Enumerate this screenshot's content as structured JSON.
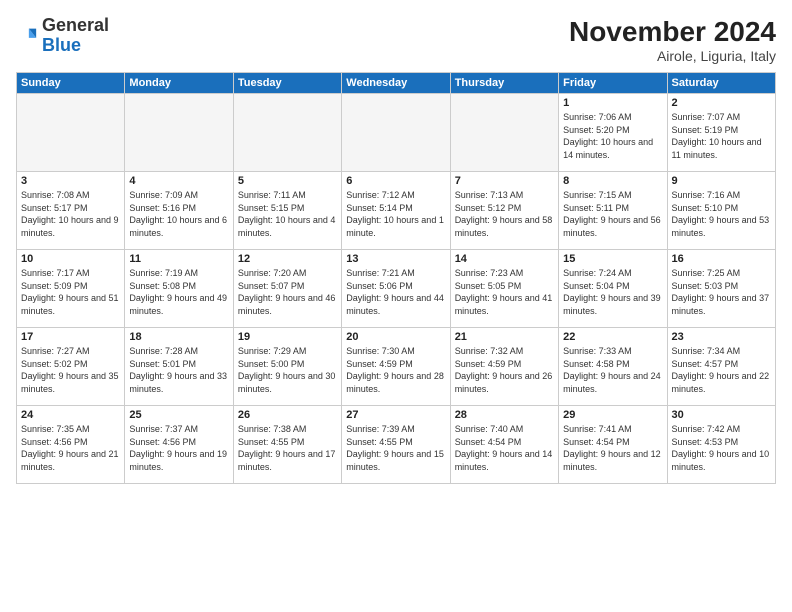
{
  "logo": {
    "general": "General",
    "blue": "Blue"
  },
  "header": {
    "title": "November 2024",
    "location": "Airole, Liguria, Italy"
  },
  "weekdays": [
    "Sunday",
    "Monday",
    "Tuesday",
    "Wednesday",
    "Thursday",
    "Friday",
    "Saturday"
  ],
  "days": [
    {
      "num": "",
      "info": ""
    },
    {
      "num": "",
      "info": ""
    },
    {
      "num": "",
      "info": ""
    },
    {
      "num": "",
      "info": ""
    },
    {
      "num": "",
      "info": ""
    },
    {
      "num": "1",
      "info": "Sunrise: 7:06 AM\nSunset: 5:20 PM\nDaylight: 10 hours and 14 minutes."
    },
    {
      "num": "2",
      "info": "Sunrise: 7:07 AM\nSunset: 5:19 PM\nDaylight: 10 hours and 11 minutes."
    },
    {
      "num": "3",
      "info": "Sunrise: 7:08 AM\nSunset: 5:17 PM\nDaylight: 10 hours and 9 minutes."
    },
    {
      "num": "4",
      "info": "Sunrise: 7:09 AM\nSunset: 5:16 PM\nDaylight: 10 hours and 6 minutes."
    },
    {
      "num": "5",
      "info": "Sunrise: 7:11 AM\nSunset: 5:15 PM\nDaylight: 10 hours and 4 minutes."
    },
    {
      "num": "6",
      "info": "Sunrise: 7:12 AM\nSunset: 5:14 PM\nDaylight: 10 hours and 1 minute."
    },
    {
      "num": "7",
      "info": "Sunrise: 7:13 AM\nSunset: 5:12 PM\nDaylight: 9 hours and 58 minutes."
    },
    {
      "num": "8",
      "info": "Sunrise: 7:15 AM\nSunset: 5:11 PM\nDaylight: 9 hours and 56 minutes."
    },
    {
      "num": "9",
      "info": "Sunrise: 7:16 AM\nSunset: 5:10 PM\nDaylight: 9 hours and 53 minutes."
    },
    {
      "num": "10",
      "info": "Sunrise: 7:17 AM\nSunset: 5:09 PM\nDaylight: 9 hours and 51 minutes."
    },
    {
      "num": "11",
      "info": "Sunrise: 7:19 AM\nSunset: 5:08 PM\nDaylight: 9 hours and 49 minutes."
    },
    {
      "num": "12",
      "info": "Sunrise: 7:20 AM\nSunset: 5:07 PM\nDaylight: 9 hours and 46 minutes."
    },
    {
      "num": "13",
      "info": "Sunrise: 7:21 AM\nSunset: 5:06 PM\nDaylight: 9 hours and 44 minutes."
    },
    {
      "num": "14",
      "info": "Sunrise: 7:23 AM\nSunset: 5:05 PM\nDaylight: 9 hours and 41 minutes."
    },
    {
      "num": "15",
      "info": "Sunrise: 7:24 AM\nSunset: 5:04 PM\nDaylight: 9 hours and 39 minutes."
    },
    {
      "num": "16",
      "info": "Sunrise: 7:25 AM\nSunset: 5:03 PM\nDaylight: 9 hours and 37 minutes."
    },
    {
      "num": "17",
      "info": "Sunrise: 7:27 AM\nSunset: 5:02 PM\nDaylight: 9 hours and 35 minutes."
    },
    {
      "num": "18",
      "info": "Sunrise: 7:28 AM\nSunset: 5:01 PM\nDaylight: 9 hours and 33 minutes."
    },
    {
      "num": "19",
      "info": "Sunrise: 7:29 AM\nSunset: 5:00 PM\nDaylight: 9 hours and 30 minutes."
    },
    {
      "num": "20",
      "info": "Sunrise: 7:30 AM\nSunset: 4:59 PM\nDaylight: 9 hours and 28 minutes."
    },
    {
      "num": "21",
      "info": "Sunrise: 7:32 AM\nSunset: 4:59 PM\nDaylight: 9 hours and 26 minutes."
    },
    {
      "num": "22",
      "info": "Sunrise: 7:33 AM\nSunset: 4:58 PM\nDaylight: 9 hours and 24 minutes."
    },
    {
      "num": "23",
      "info": "Sunrise: 7:34 AM\nSunset: 4:57 PM\nDaylight: 9 hours and 22 minutes."
    },
    {
      "num": "24",
      "info": "Sunrise: 7:35 AM\nSunset: 4:56 PM\nDaylight: 9 hours and 21 minutes."
    },
    {
      "num": "25",
      "info": "Sunrise: 7:37 AM\nSunset: 4:56 PM\nDaylight: 9 hours and 19 minutes."
    },
    {
      "num": "26",
      "info": "Sunrise: 7:38 AM\nSunset: 4:55 PM\nDaylight: 9 hours and 17 minutes."
    },
    {
      "num": "27",
      "info": "Sunrise: 7:39 AM\nSunset: 4:55 PM\nDaylight: 9 hours and 15 minutes."
    },
    {
      "num": "28",
      "info": "Sunrise: 7:40 AM\nSunset: 4:54 PM\nDaylight: 9 hours and 14 minutes."
    },
    {
      "num": "29",
      "info": "Sunrise: 7:41 AM\nSunset: 4:54 PM\nDaylight: 9 hours and 12 minutes."
    },
    {
      "num": "30",
      "info": "Sunrise: 7:42 AM\nSunset: 4:53 PM\nDaylight: 9 hours and 10 minutes."
    }
  ]
}
